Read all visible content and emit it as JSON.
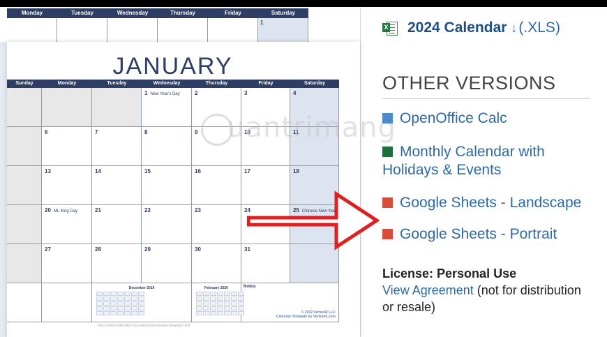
{
  "back_calendar": {
    "days": [
      "Monday",
      "Tuesday",
      "Wednesday",
      "Thursday",
      "Friday",
      "Saturday"
    ],
    "first_date": "1"
  },
  "front_calendar": {
    "month": "JANUARY",
    "days": [
      "Sunday",
      "Monday",
      "Tuesday",
      "Wednesday",
      "Thursday",
      "Friday",
      "Saturday"
    ],
    "weeks": [
      [
        "",
        "",
        "",
        "1",
        "2",
        "3",
        "4"
      ],
      [
        "",
        "6",
        "7",
        "8",
        "9",
        "10",
        "11"
      ],
      [
        "",
        "13",
        "14",
        "15",
        "16",
        "17",
        "18"
      ],
      [
        "",
        "20",
        "21",
        "22",
        "23",
        "24",
        "25"
      ],
      [
        "",
        "27",
        "28",
        "29",
        "30",
        "31",
        ""
      ]
    ],
    "events": {
      "new_years": "New Year's Day",
      "ml_king": "ML King Day",
      "chinese_new_year": "Chinese New Year"
    },
    "mini_dec_title": "December 2019",
    "mini_feb_title": "February 2020",
    "notes_label": "Notes:",
    "copyright": "© 2019 Vertex42 LLC",
    "template_credit": "Calendar Template by Vertex42.com",
    "url": "https://www.vertex42.com/calendars/calendar-template.html"
  },
  "watermark": "uantrimang",
  "download": {
    "icon": "excel-file-icon",
    "title": "2024 Calendar",
    "arrow": "↓",
    "ext": "(.XLS)"
  },
  "other_versions": {
    "title": "OTHER VERSIONS",
    "items": [
      {
        "label": "OpenOffice Calc",
        "color": "#4a8cc9"
      },
      {
        "label": "Monthly Calendar with Holidays & Events",
        "color": "#1f6e3c"
      },
      {
        "label": "Google Sheets - Landscape",
        "color": "#db4b3a"
      },
      {
        "label": "Google Sheets - Portrait",
        "color": "#db4b3a"
      }
    ]
  },
  "license": {
    "label": "License: Personal Use",
    "link": "View Agreement",
    "note": "(not for distribution or resale)"
  }
}
